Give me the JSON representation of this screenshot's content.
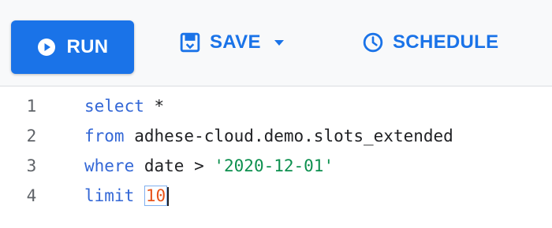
{
  "toolbar": {
    "run_label": "RUN",
    "save_label": "SAVE",
    "schedule_label": "SCHEDULE",
    "icons": {
      "run": "play-circle-icon",
      "save": "save-icon",
      "save_menu": "dropdown-caret-icon",
      "schedule": "clock-icon"
    }
  },
  "editor": {
    "lines": [
      {
        "number": "1",
        "keyword": "select",
        "rest": " *"
      },
      {
        "number": "2",
        "keyword": "from",
        "rest": " adhese-cloud.demo.slots_extended"
      },
      {
        "number": "3",
        "keyword": "where",
        "rest": " date > ",
        "string": "'2020-12-01'"
      },
      {
        "number": "4",
        "keyword": "limit",
        "rest": " ",
        "number_literal": "10"
      }
    ]
  },
  "colors": {
    "accent": "#1a73e8",
    "keyword": "#3367d6",
    "string": "#0d904f",
    "number": "#e8541c",
    "toolbar_bg": "#f8f9fa"
  }
}
